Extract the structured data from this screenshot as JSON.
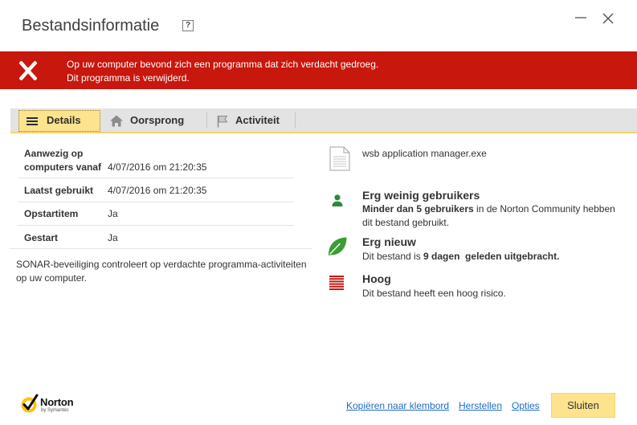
{
  "window": {
    "title": "Bestandsinformatie",
    "help_label": "?",
    "minimize_icon": "minimize-icon",
    "close_icon": "close-icon"
  },
  "alert": {
    "icon": "close-x-icon",
    "background": "#c8170d",
    "line1": "Op uw computer bevond zich een programma dat zich verdacht gedroeg.",
    "line2": "Dit programma is verwijderd."
  },
  "tabs": [
    {
      "label": "Details",
      "icon": "list-icon",
      "selected": true
    },
    {
      "label": "Oorsprong",
      "icon": "house-icon",
      "selected": false
    },
    {
      "label": "Activiteit",
      "icon": "flag-icon",
      "selected": false
    }
  ],
  "details": {
    "rows": [
      {
        "label": "Aanwezig op computers vanaf",
        "value": "4/07/2016 om 21:20:35"
      },
      {
        "label": "Laatst gebruikt",
        "value": "4/07/2016 om 21:20:35"
      },
      {
        "label": "Opstartitem",
        "value": "Ja"
      },
      {
        "label": "Gestart",
        "value": "Ja"
      }
    ],
    "note": "SONAR-beveiliging controleert op verdachte programma-activiteiten op uw computer."
  },
  "file": {
    "icon": "file-icon",
    "name": "wsb application manager.exe"
  },
  "ratings": [
    {
      "icon": "user-icon",
      "color": "#2d8a3e",
      "title": "Erg weinig gebruikers",
      "desc_bold": "Minder dan 5 gebruikers",
      "desc_suffix": " in de Norton Community hebben dit bestand gebruikt."
    },
    {
      "icon": "leaf-icon",
      "color": "#3c9c36",
      "title": "Erg nieuw",
      "desc_prefix": "Dit bestand is ",
      "desc_bold": "9 dagen  geleden uitgebracht."
    },
    {
      "icon": "risk-bars-icon",
      "color": "#c11a12",
      "title": "Hoog",
      "desc_prefix": "Dit bestand heeft een hoog risico."
    }
  ],
  "footer": {
    "logo": {
      "icon": "norton-check-icon",
      "brand": "Norton",
      "byline": "by Symantec"
    },
    "links": [
      {
        "label": "Kopiëren naar klembord"
      },
      {
        "label": "Herstellen"
      },
      {
        "label": "Opties"
      }
    ],
    "close_button": {
      "label": "Sluiten",
      "background": "#fde38d"
    }
  },
  "colors": {
    "accent_yellow": "#fde38d",
    "tab_underline": "#f5d46a",
    "link": "#1c6fbd",
    "alert_red": "#c8170d"
  }
}
